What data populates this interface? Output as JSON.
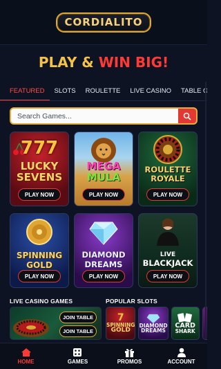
{
  "app": {
    "logo_text": "CORDIALITO"
  },
  "hero": {
    "part1": "PLAY & ",
    "part2": "WIN BIG!"
  },
  "tabs": [
    "FEATURED",
    "SLOTS",
    "ROULETTE",
    "LIVE CASINO",
    "TABLE GAMES"
  ],
  "search": {
    "placeholder": "Search Games..."
  },
  "games": [
    {
      "line1": "LUCKY",
      "line2": "SEVENS",
      "art_text": "777",
      "button": "PLAY NOW"
    },
    {
      "line1": "MEGA",
      "line2": "MULA",
      "button": "PLAY NOW"
    },
    {
      "line1": "ROULETTE",
      "line2": "ROYALE",
      "button": "PLAY NOW"
    },
    {
      "line1": "SPINNING",
      "line2": "GOLD",
      "button": "PLAY NOW"
    },
    {
      "line1": "DIAMOND",
      "line2": "DREAMS",
      "button": "PLAY NOW"
    },
    {
      "line1": "LIVE",
      "line2": "BLACKJACK",
      "button": "PLAY NOW"
    }
  ],
  "live_casino": {
    "heading": "LIVE CASINO GAMES",
    "join_label": "JOIN TABLE"
  },
  "popular_slots": {
    "heading": "POPULAR SLOTS",
    "items": [
      {
        "line1": "SPINNING",
        "line2": "GOLD",
        "art_text": "7"
      },
      {
        "line1": "DIAMOND",
        "line2": "DREAMS"
      },
      {
        "line1": "CARD",
        "line2": "SHARK"
      }
    ]
  },
  "nav": [
    {
      "label": "HOME",
      "icon": "home-icon",
      "active": true
    },
    {
      "label": "GAMES",
      "icon": "dice-icon"
    },
    {
      "label": "PROMOS",
      "icon": "gift-icon"
    },
    {
      "label": "ACCOUNT",
      "icon": "user-icon"
    }
  ],
  "colors": {
    "accent_red": "#ff3a34",
    "gold": "#f4c14a",
    "background": "#0d1322"
  }
}
